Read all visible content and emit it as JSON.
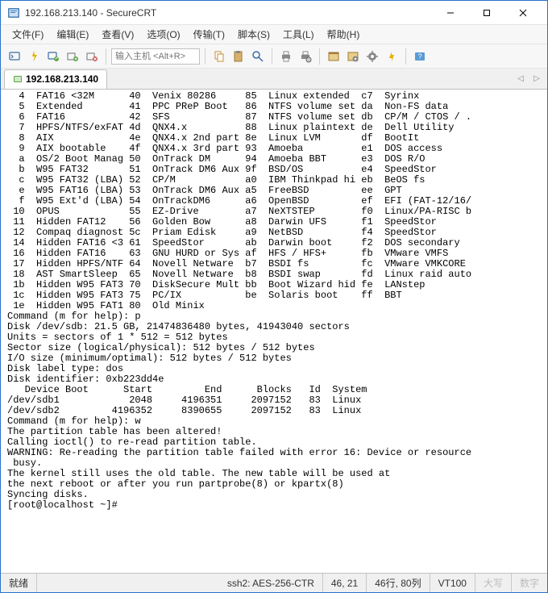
{
  "window": {
    "title": "192.168.213.140 - SecureCRT"
  },
  "menu": {
    "file": "文件(F)",
    "edit": "编辑(E)",
    "view": "查看(V)",
    "options": "选项(O)",
    "transfer": "传输(T)",
    "script": "脚本(S)",
    "tools": "工具(L)",
    "help": "帮助(H)"
  },
  "toolbar": {
    "host_placeholder": "输入主机 <Alt+R>"
  },
  "tab": {
    "label": "192.168.213.140"
  },
  "terminal": {
    "lines": [
      "  4  FAT16 <32M      40  Venix 80286     85  Linux extended  c7  Syrinx",
      "  5  Extended        41  PPC PReP Boot   86  NTFS volume set da  Non-FS data",
      "  6  FAT16           42  SFS             87  NTFS volume set db  CP/M / CTOS / .",
      "  7  HPFS/NTFS/exFAT 4d  QNX4.x          88  Linux plaintext de  Dell Utility",
      "  8  AIX             4e  QNX4.x 2nd part 8e  Linux LVM       df  BootIt",
      "  9  AIX bootable    4f  QNX4.x 3rd part 93  Amoeba          e1  DOS access",
      "  a  OS/2 Boot Manag 50  OnTrack DM      94  Amoeba BBT      e3  DOS R/O",
      "  b  W95 FAT32       51  OnTrack DM6 Aux 9f  BSD/OS          e4  SpeedStor",
      "  c  W95 FAT32 (LBA) 52  CP/M            a0  IBM Thinkpad hi eb  BeOS fs",
      "  e  W95 FAT16 (LBA) 53  OnTrack DM6 Aux a5  FreeBSD         ee  GPT",
      "  f  W95 Ext'd (LBA) 54  OnTrackDM6      a6  OpenBSD         ef  EFI (FAT-12/16/",
      " 10  OPUS            55  EZ-Drive        a7  NeXTSTEP        f0  Linux/PA-RISC b",
      " 11  Hidden FAT12    56  Golden Bow      a8  Darwin UFS      f1  SpeedStor",
      " 12  Compaq diagnost 5c  Priam Edisk     a9  NetBSD          f4  SpeedStor",
      " 14  Hidden FAT16 <3 61  SpeedStor       ab  Darwin boot     f2  DOS secondary",
      " 16  Hidden FAT16    63  GNU HURD or Sys af  HFS / HFS+      fb  VMware VMFS",
      " 17  Hidden HPFS/NTF 64  Novell Netware  b7  BSDI fs         fc  VMware VMKCORE",
      " 18  AST SmartSleep  65  Novell Netware  b8  BSDI swap       fd  Linux raid auto",
      " 1b  Hidden W95 FAT3 70  DiskSecure Mult bb  Boot Wizard hid fe  LANstep",
      " 1c  Hidden W95 FAT3 75  PC/IX           be  Solaris boot    ff  BBT",
      " 1e  Hidden W95 FAT1 80  Old Minix",
      "",
      "Command (m for help): p",
      "",
      "Disk /dev/sdb: 21.5 GB, 21474836480 bytes, 41943040 sectors",
      "Units = sectors of 1 * 512 = 512 bytes",
      "Sector size (logical/physical): 512 bytes / 512 bytes",
      "I/O size (minimum/optimal): 512 bytes / 512 bytes",
      "Disk label type: dos",
      "Disk identifier: 0xb223dd4e",
      "",
      "   Device Boot      Start         End      Blocks   Id  System",
      "/dev/sdb1            2048     4196351     2097152   83  Linux",
      "/dev/sdb2         4196352     8390655     2097152   83  Linux",
      "",
      "Command (m for help): w",
      "The partition table has been altered!",
      "",
      "Calling ioctl() to re-read partition table.",
      "",
      "WARNING: Re-reading the partition table failed with error 16: Device or resource",
      " busy.",
      "The kernel still uses the old table. The new table will be used at",
      "the next reboot or after you run partprobe(8) or kpartx(8)",
      "Syncing disks.",
      "[root@localhost ~]#"
    ]
  },
  "status": {
    "ready": "就绪",
    "cipher": "ssh2: AES-256-CTR",
    "pos": "46,  21",
    "size": "46行, 80列",
    "emul": "VT100",
    "caps": "大写",
    "num": "数字"
  }
}
